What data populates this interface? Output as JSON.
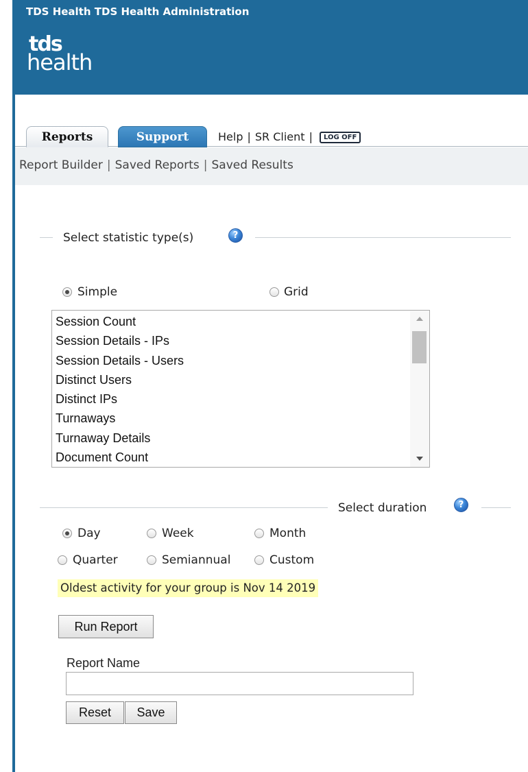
{
  "header": {
    "title": "TDS Health TDS Health Administration",
    "logo_line1": "tds",
    "logo_line2": "health",
    "bg_color": "#1f6a9a"
  },
  "tabs": [
    {
      "label": "Reports",
      "active": true
    },
    {
      "label": "Support",
      "active": false
    }
  ],
  "top_links": {
    "help": "Help",
    "sr_client": "SR Client",
    "separator": "|",
    "logoff": "LOG OFF"
  },
  "subnav": {
    "items": [
      "Report Builder",
      "Saved Reports",
      "Saved Results"
    ],
    "separator": "|"
  },
  "statistic_section": {
    "title": "Select statistic type(s)",
    "help_icon": "?",
    "radios": [
      {
        "label": "Simple",
        "checked": true
      },
      {
        "label": "Grid",
        "checked": false
      }
    ],
    "list_items": [
      "Session Count",
      "Session Details - IPs",
      "Session Details - Users",
      "Distinct Users",
      "Distinct IPs",
      "Turnaways",
      "Turnaway Details",
      "Document Count"
    ]
  },
  "duration_section": {
    "title": "Select duration",
    "help_icon": "?",
    "options": [
      {
        "label": "Day",
        "checked": true
      },
      {
        "label": "Week",
        "checked": false
      },
      {
        "label": "Month",
        "checked": false
      },
      {
        "label": "Quarter",
        "checked": false
      },
      {
        "label": "Semiannual",
        "checked": false
      },
      {
        "label": "Custom",
        "checked": false
      }
    ],
    "notice": "Oldest activity for your group is Nov 14 2019",
    "notice_color": "#ffffb8"
  },
  "actions": {
    "run_report": "Run Report",
    "report_name_label": "Report Name",
    "report_name_value": "",
    "reset": "Reset",
    "save": "Save"
  }
}
